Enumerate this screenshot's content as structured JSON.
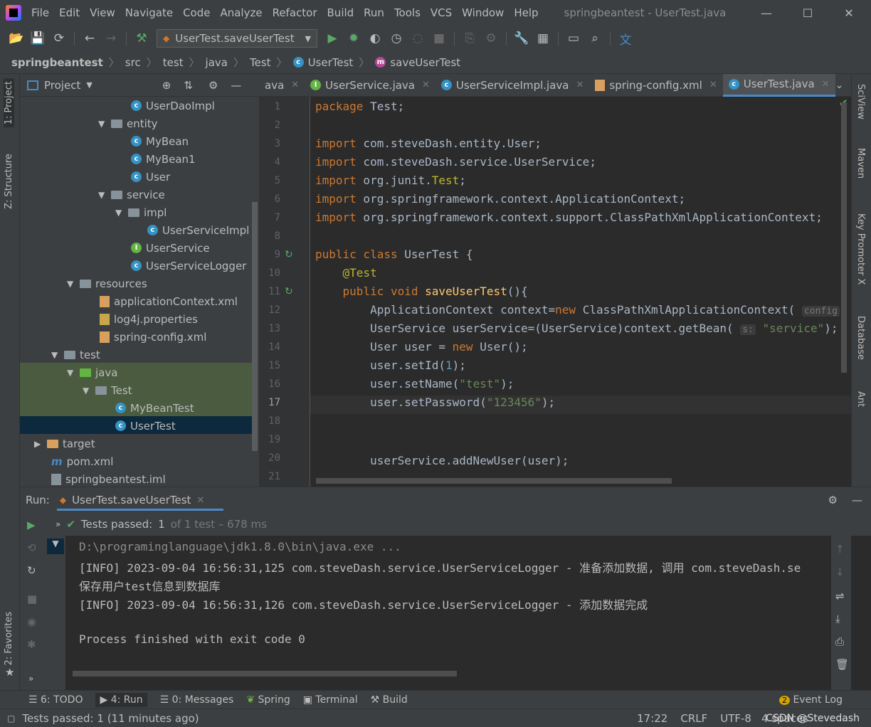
{
  "menu": {
    "items": [
      "File",
      "Edit",
      "View",
      "Navigate",
      "Code",
      "Analyze",
      "Refactor",
      "Build",
      "Run",
      "Tools",
      "VCS",
      "Window",
      "Help"
    ],
    "window_title": "springbeantest - UserTest.java"
  },
  "toolbar": {
    "run_config": "UserTest.saveUserTest"
  },
  "breadcrumb": [
    "springbeantest",
    "src",
    "test",
    "java",
    "Test",
    "UserTest",
    "saveUserTest"
  ],
  "left_strip": {
    "project_tab": "1: Project",
    "structure_tab": "Z: Structure",
    "favorites_tab": "2: Favorites"
  },
  "right_strip": {
    "sciview": "SciView",
    "maven": "Maven",
    "key_promoter": "Key Promoter X",
    "database": "Database",
    "ant": "Ant"
  },
  "project_panel": {
    "title": "Project",
    "tree": [
      {
        "label": "UserDaoImpl",
        "icon": "class-icon"
      },
      {
        "label": "entity",
        "icon": "folder-icon"
      },
      {
        "label": "MyBean",
        "icon": "class-icon"
      },
      {
        "label": "MyBean1",
        "icon": "class-icon"
      },
      {
        "label": "User",
        "icon": "class-icon"
      },
      {
        "label": "service",
        "icon": "folder-icon"
      },
      {
        "label": "impl",
        "icon": "folder-icon"
      },
      {
        "label": "UserServiceImpl",
        "icon": "class-icon"
      },
      {
        "label": "UserService",
        "icon": "interface-icon"
      },
      {
        "label": "UserServiceLogger",
        "icon": "class-icon"
      },
      {
        "label": "resources",
        "icon": "folder-icon"
      },
      {
        "label": "applicationContext.xml",
        "icon": "xml-icon"
      },
      {
        "label": "log4j.properties",
        "icon": "properties-icon"
      },
      {
        "label": "spring-config.xml",
        "icon": "xml-icon"
      },
      {
        "label": "test",
        "icon": "folder-icon"
      },
      {
        "label": "java",
        "icon": "folder-icon"
      },
      {
        "label": "Test",
        "icon": "folder-icon"
      },
      {
        "label": "MyBeanTest",
        "icon": "class-icon"
      },
      {
        "label": "UserTest",
        "icon": "class-icon"
      },
      {
        "label": "target",
        "icon": "folder-icon"
      },
      {
        "label": "pom.xml",
        "icon": "maven-icon"
      },
      {
        "label": "springbeantest.iml",
        "icon": "iml-icon"
      }
    ]
  },
  "editor": {
    "tabs": [
      "ava",
      "UserService.java",
      "UserServiceImpl.java",
      "spring-config.xml",
      "UserTest.java"
    ],
    "line_numbers": [
      "1",
      "2",
      "3",
      "4",
      "5",
      "6",
      "7",
      "8",
      "9",
      "10",
      "11",
      "12",
      "13",
      "14",
      "15",
      "16",
      "17",
      "18",
      "19",
      "20",
      "21"
    ],
    "code": {
      "l1a": "package",
      "l1b": " Test;",
      "imp": "import",
      "l3": " com.steveDash.entity.User;",
      "l4": " com.steveDash.service.UserService;",
      "l5a": " org.junit.",
      "l5b": "Test",
      "l5c": ";",
      "l6": " org.springframework.context.ApplicationContext;",
      "l7": " org.springframework.context.support.ClassPathXmlApplicationContext;",
      "l9a": "public class",
      "l9b": " UserTest {",
      "l10": "    @Test",
      "l11a": "    public void",
      "l11b": " saveUserTest",
      "l11c": "(){",
      "l12a": "        ApplicationContext context=",
      "l12b": "new",
      "l12c": " ClassPathXmlApplicationContext( ",
      "l12d": "config",
      "l13a": "        UserService userService=(UserService)context.getBean( ",
      "l13b": "s:",
      "l13c": " \"service\"",
      "l13d": ");",
      "l14a": "        User user = ",
      "l14b": "new",
      "l14c": " User();",
      "l15a": "        user.setId(",
      "l15b": "1",
      "l15c": ");",
      "l16a": "        user.setName(",
      "l16b": "\"test\"",
      "l16c": ");",
      "l17a": "        user.setPassword(",
      "l17b": "\"123456\"",
      "l17c": ");",
      "l20": "        userService.addNewUser(user);"
    }
  },
  "run_panel": {
    "label": "Run:",
    "tab": "UserTest.saveUserTest",
    "tests_passed": "Tests passed:",
    "tests_count": "1",
    "tests_detail": "of 1 test – 678 ms",
    "console": [
      "D:\\programinglanguage\\jdk1.8.0\\bin\\java.exe ...",
      "[INFO] 2023-09-04 16:56:31,125 com.steveDash.service.UserServiceLogger - 准备添加数据, 调用 com.steveDash.se",
      "保存用户test信息到数据库",
      "[INFO] 2023-09-04 16:56:31,126 com.steveDash.service.UserServiceLogger - 添加数据完成",
      "",
      "Process finished with exit code 0"
    ]
  },
  "bottom_tabs": {
    "todo": "6: TODO",
    "run": "4: Run",
    "messages": "0: Messages",
    "spring": "Spring",
    "terminal": "Terminal",
    "build": "Build",
    "event_count": "2",
    "event_log": "Event Log"
  },
  "status": {
    "message": "Tests passed: 1 (11 minutes ago)",
    "position": "17:22",
    "line_sep": "CRLF",
    "encoding": "UTF-8",
    "indent": "4 spaces",
    "watermark": "CSDN @Stevedash"
  }
}
